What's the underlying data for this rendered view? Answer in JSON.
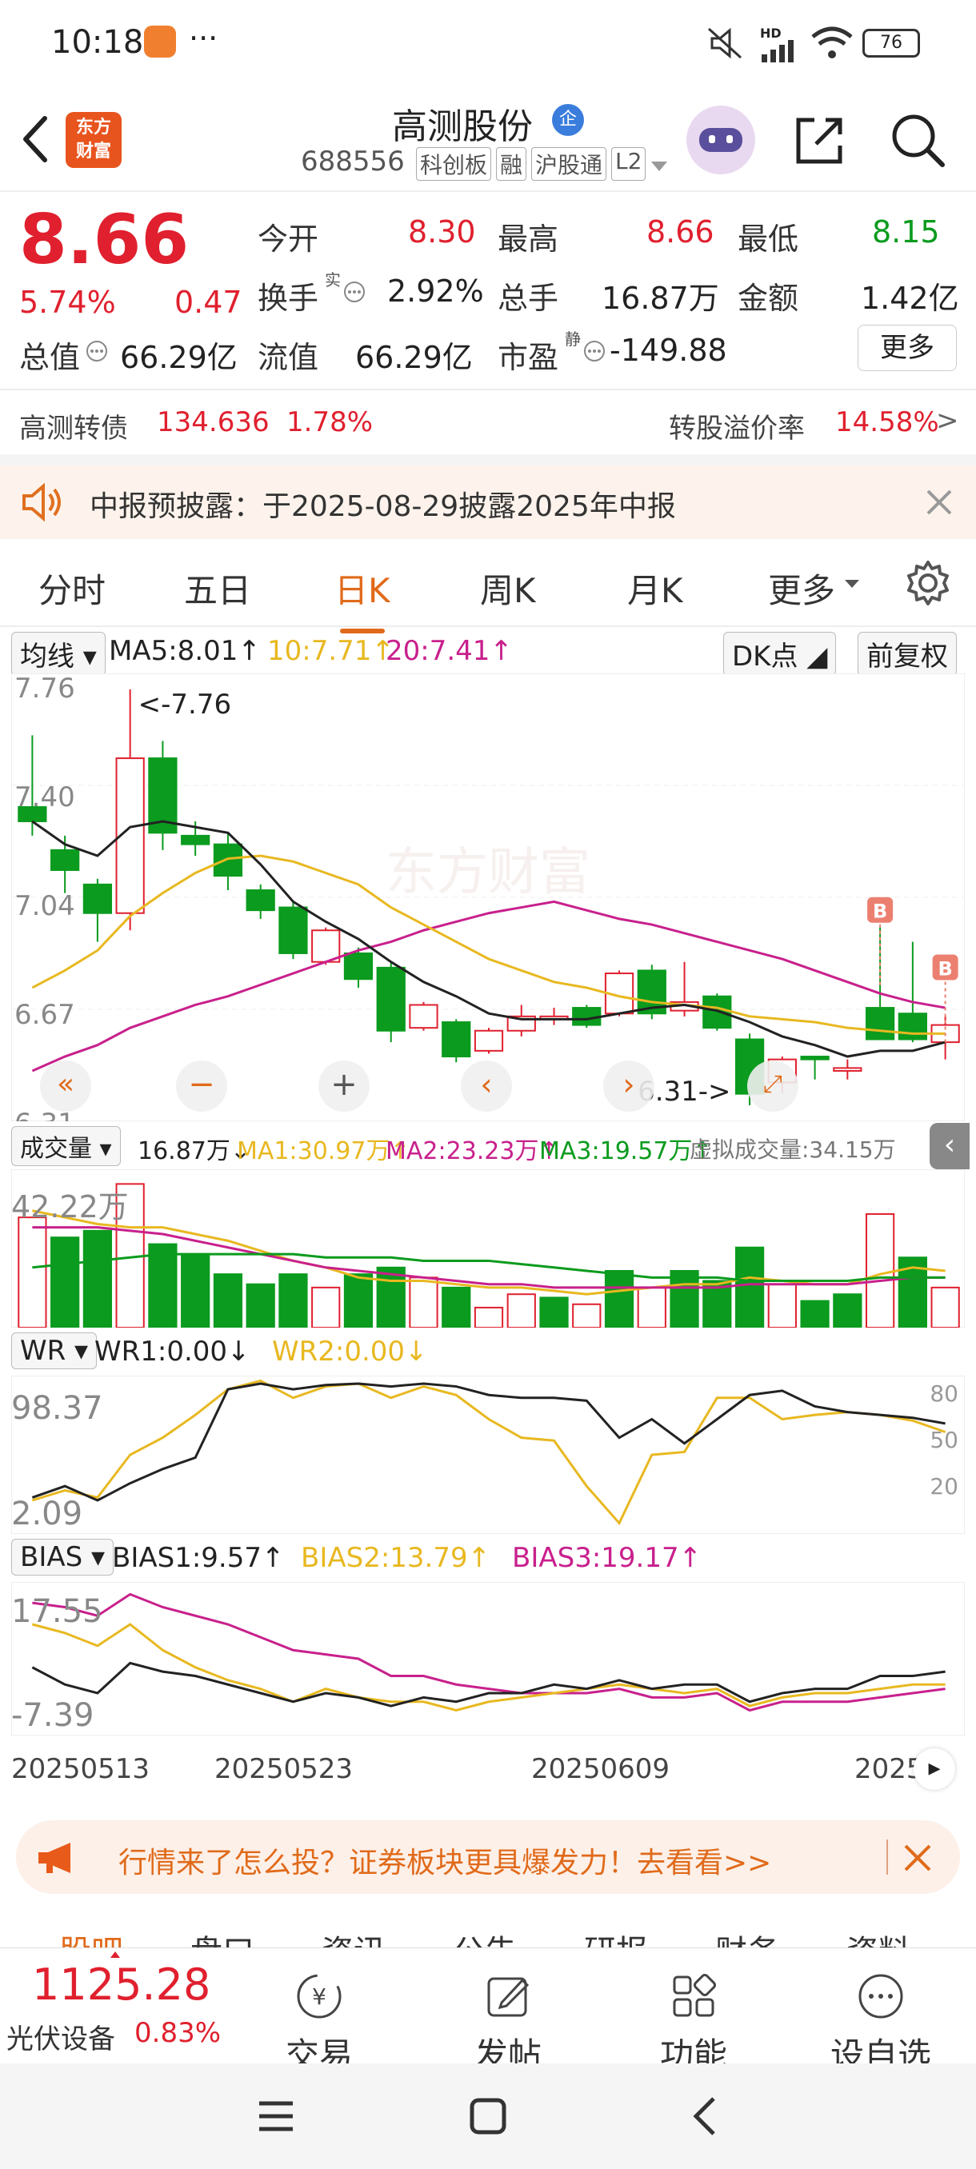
{
  "status_bar": {
    "time": "10:18",
    "dots": "···",
    "net": "HD",
    "battery": "76"
  },
  "header": {
    "title": "高测股份",
    "title_badge": "企",
    "logo_line1": "东方",
    "logo_line2": "财富",
    "code": "688556",
    "tags": [
      "科创板",
      "融",
      "沪股通",
      "L2"
    ]
  },
  "quote": {
    "price": "8.66",
    "change_pct": "5.74%",
    "change_amt": "0.47",
    "rows": [
      [
        {
          "label": "今开",
          "value": "8.30",
          "color": "red"
        },
        {
          "label": "最高",
          "value": "8.66",
          "color": "red"
        },
        {
          "label": "最低",
          "value": "8.15",
          "color": "green"
        }
      ],
      [
        {
          "label": "换手",
          "sup": "实",
          "value": "2.92%",
          "color": "black"
        },
        {
          "label": "总手",
          "value": "16.87万",
          "color": "black"
        },
        {
          "label": "金额",
          "value": "1.42亿",
          "color": "black"
        }
      ]
    ],
    "total_cap_label": "总值",
    "total_cap": "66.29亿",
    "float_cap_label": "流值",
    "float_cap": "66.29亿",
    "pe_label": "市盈",
    "pe_sup": "静",
    "pe": "-149.88",
    "more_button": "更多"
  },
  "convertible": {
    "name": "高测转债",
    "price": "134.636",
    "pct": "1.78%",
    "premium_label": "转股溢价率",
    "premium": "14.58%",
    "arrow": ">"
  },
  "notice": {
    "text": "中报预披露：于2025-08-29披露2025年中报"
  },
  "tabs": [
    "分时",
    "五日",
    "日K",
    "周K",
    "月K",
    "更多"
  ],
  "active_tab": "日K",
  "ma_row": {
    "selector": "均线",
    "ma5": "MA5:8.01↑",
    "ma10": "10:7.71↑",
    "ma20": "20:7.41↑",
    "dk": "DK点",
    "adjust": "前复权"
  },
  "kline": {
    "y_labels": [
      "7.76",
      "7.40",
      "7.04",
      "6.67",
      "6.31"
    ],
    "high_note": "<-7.76",
    "low_note": "6.31->",
    "signal": "B"
  },
  "volume_row": {
    "selector": "成交量",
    "value": "16.87万↓",
    "ma1": "MA1:30.97万↑",
    "ma2": "MA2:23.23万↑",
    "ma3": "MA3:19.57万↑",
    "virtual": "虚拟成交量:34.15万",
    "axis": "42.22万"
  },
  "wr_row": {
    "selector": "WR",
    "wr1": "WR1:0.00↓",
    "wr2": "WR2:0.00↓",
    "axis_top": "98.37",
    "axis_bottom": "2.09",
    "ref": [
      "80",
      "50",
      "20"
    ]
  },
  "bias_row": {
    "selector": "BIAS",
    "b1": "BIAS1:9.57↑",
    "b2": "BIAS2:13.79↑",
    "b3": "BIAS3:19.17↑",
    "axis_top": "17.55",
    "axis_bottom": "-7.39"
  },
  "dates": [
    "20250513",
    "20250523",
    "20250609",
    "2025"
  ],
  "ad": {
    "text": "行情来了怎么投？证券板块更具爆发力！去看看>>"
  },
  "subtabs": [
    "股吧",
    "盘口",
    "资讯",
    "公告",
    "研报",
    "财务",
    "资料"
  ],
  "bottom": {
    "index_value": "1125.28",
    "index_name": "光伏设备",
    "index_pct": "0.83%",
    "items": [
      "交易",
      "发帖",
      "功能",
      "设自选"
    ]
  },
  "chart_data": {
    "type": "candlestick",
    "y_range": [
      6.31,
      7.76
    ],
    "candles": [
      {
        "o": 7.35,
        "c": 7.3,
        "h": 7.6,
        "l": 7.25
      },
      {
        "o": 7.2,
        "c": 7.13,
        "h": 7.25,
        "l": 7.05
      },
      {
        "o": 7.08,
        "c": 6.98,
        "h": 7.1,
        "l": 6.88
      },
      {
        "o": 6.98,
        "c": 7.52,
        "h": 7.76,
        "l": 6.92
      },
      {
        "o": 7.52,
        "c": 7.26,
        "h": 7.58,
        "l": 7.2
      },
      {
        "o": 7.25,
        "c": 7.22,
        "h": 7.3,
        "l": 7.18
      },
      {
        "o": 7.22,
        "c": 7.11,
        "h": 7.26,
        "l": 7.06
      },
      {
        "o": 7.06,
        "c": 6.99,
        "h": 7.08,
        "l": 6.96
      },
      {
        "o": 7.0,
        "c": 6.84,
        "h": 7.02,
        "l": 6.82
      },
      {
        "o": 6.81,
        "c": 6.92,
        "h": 6.93,
        "l": 6.8
      },
      {
        "o": 6.84,
        "c": 6.75,
        "h": 6.86,
        "l": 6.72
      },
      {
        "o": 6.79,
        "c": 6.57,
        "h": 6.81,
        "l": 6.53
      },
      {
        "o": 6.58,
        "c": 6.66,
        "h": 6.67,
        "l": 6.57
      },
      {
        "o": 6.6,
        "c": 6.48,
        "h": 6.61,
        "l": 6.46
      },
      {
        "o": 6.5,
        "c": 6.57,
        "h": 6.58,
        "l": 6.49
      },
      {
        "o": 6.57,
        "c": 6.62,
        "h": 6.66,
        "l": 6.55
      },
      {
        "o": 6.61,
        "c": 6.62,
        "h": 6.65,
        "l": 6.59
      },
      {
        "o": 6.65,
        "c": 6.59,
        "h": 6.66,
        "l": 6.58
      },
      {
        "o": 6.63,
        "c": 6.77,
        "h": 6.78,
        "l": 6.62
      },
      {
        "o": 6.78,
        "c": 6.63,
        "h": 6.8,
        "l": 6.61
      },
      {
        "o": 6.64,
        "c": 6.67,
        "h": 6.81,
        "l": 6.62
      },
      {
        "o": 6.69,
        "c": 6.58,
        "h": 6.7,
        "l": 6.57
      },
      {
        "o": 6.54,
        "c": 6.35,
        "h": 6.56,
        "l": 6.31
      },
      {
        "o": 6.39,
        "c": 6.47,
        "h": 6.48,
        "l": 6.35
      },
      {
        "o": 6.48,
        "c": 6.47,
        "h": 6.48,
        "l": 6.4
      },
      {
        "o": 6.43,
        "c": 6.44,
        "h": 6.47,
        "l": 6.4
      },
      {
        "o": 6.65,
        "c": 6.54,
        "h": 6.93,
        "l": 6.54
      },
      {
        "o": 6.63,
        "c": 6.54,
        "h": 6.88,
        "l": 6.53
      },
      {
        "o": 6.53,
        "c": 6.59,
        "h": 6.62,
        "l": 6.47
      }
    ],
    "ma5": [
      7.3,
      7.22,
      7.18,
      7.28,
      7.3,
      7.28,
      7.26,
      7.15,
      7.02,
      6.95,
      6.89,
      6.81,
      6.74,
      6.69,
      6.63,
      6.61,
      6.61,
      6.61,
      6.63,
      6.65,
      6.66,
      6.64,
      6.6,
      6.55,
      6.52,
      6.48,
      6.5,
      6.5,
      6.53
    ],
    "ma10": [
      6.72,
      6.78,
      6.85,
      6.97,
      7.05,
      7.12,
      7.17,
      7.18,
      7.16,
      7.12,
      7.08,
      7.0,
      6.94,
      6.88,
      6.82,
      6.78,
      6.74,
      6.72,
      6.69,
      6.67,
      6.66,
      6.65,
      6.62,
      6.61,
      6.6,
      6.58,
      6.57,
      6.56,
      6.56
    ],
    "ma20": [
      6.43,
      6.48,
      6.52,
      6.58,
      6.62,
      6.66,
      6.69,
      6.73,
      6.77,
      6.81,
      6.85,
      6.88,
      6.92,
      6.95,
      6.98,
      7.0,
      7.02,
      6.99,
      6.96,
      6.94,
      6.91,
      6.88,
      6.85,
      6.82,
      6.78,
      6.74,
      6.7,
      6.67,
      6.65
    ],
    "volume": [
      33,
      27,
      29,
      43,
      25,
      22,
      16,
      13,
      16,
      12,
      16,
      18,
      15,
      12,
      6,
      10,
      9,
      7,
      17,
      12,
      17,
      14,
      24,
      13,
      8,
      10,
      34,
      21,
      12
    ],
    "volume_up": [
      true,
      false,
      false,
      true,
      false,
      false,
      false,
      false,
      false,
      true,
      false,
      false,
      true,
      false,
      true,
      true,
      false,
      true,
      false,
      true,
      false,
      false,
      false,
      true,
      false,
      false,
      true,
      false,
      true
    ],
    "series": [
      {
        "name": "MA5",
        "color": "#222222"
      },
      {
        "name": "MA10",
        "color": "#e8b820"
      },
      {
        "name": "MA20",
        "color": "#c8208c"
      }
    ]
  },
  "colors": {
    "up": "#e0202e",
    "down": "#0b9b1e",
    "accent": "#e06a1a"
  }
}
